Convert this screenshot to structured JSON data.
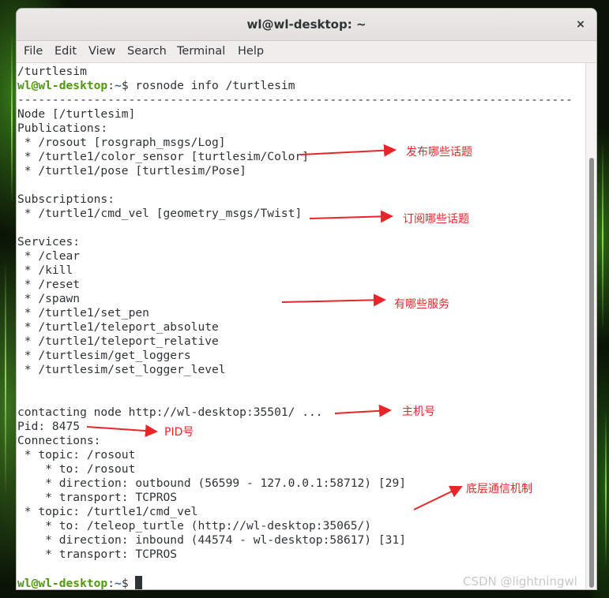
{
  "window": {
    "title": "wl@wl-desktop: ~",
    "close_glyph": "×"
  },
  "menu": [
    "File",
    "Edit",
    "View",
    "Search",
    "Terminal",
    "Help"
  ],
  "prompt": {
    "user_host": "wl@wl-desktop",
    "separator": ":",
    "path": "~",
    "symbol": "$"
  },
  "terminal": {
    "line_prev": "/turtlesim",
    "command": " rosnode info /turtlesim",
    "separator_line": "--------------------------------------------------------------------------------",
    "node_line": "Node [/turtlesim]",
    "publications_header": "Publications:",
    "publications": [
      " * /rosout [rosgraph_msgs/Log]",
      " * /turtle1/color_sensor [turtlesim/Color]",
      " * /turtle1/pose [turtlesim/Pose]"
    ],
    "subscriptions_header": "Subscriptions:",
    "subscriptions": [
      " * /turtle1/cmd_vel [geometry_msgs/Twist]"
    ],
    "services_header": "Services:",
    "services": [
      " * /clear",
      " * /kill",
      " * /reset",
      " * /spawn",
      " * /turtle1/set_pen",
      " * /turtle1/teleport_absolute",
      " * /turtle1/teleport_relative",
      " * /turtlesim/get_loggers",
      " * /turtlesim/set_logger_level"
    ],
    "contacting": "contacting node http://wl-desktop:35501/ ...",
    "pid": "Pid: 8475",
    "connections_header": "Connections:",
    "connections": [
      " * topic: /rosout",
      "    * to: /rosout",
      "    * direction: outbound (56599 - 127.0.0.1:58712) [29]",
      "    * transport: TCPROS",
      " * topic: /turtle1/cmd_vel",
      "    * to: /teleop_turtle (http://wl-desktop:35065/)",
      "    * direction: inbound (44574 - wl-desktop:58617) [31]",
      "    * transport: TCPROS"
    ]
  },
  "annotations": {
    "publications": "发布哪些话题",
    "subscriptions": "订阅哪些话题",
    "services": "有哪些服务",
    "host": "主机号",
    "pid": "PID号",
    "transport": "底层通信机制"
  },
  "watermark": "CSDN @lightningwl",
  "colors": {
    "prompt_green": "#4e9a06",
    "prompt_blue": "#3465a4",
    "annotation_red": "#e8262a"
  }
}
